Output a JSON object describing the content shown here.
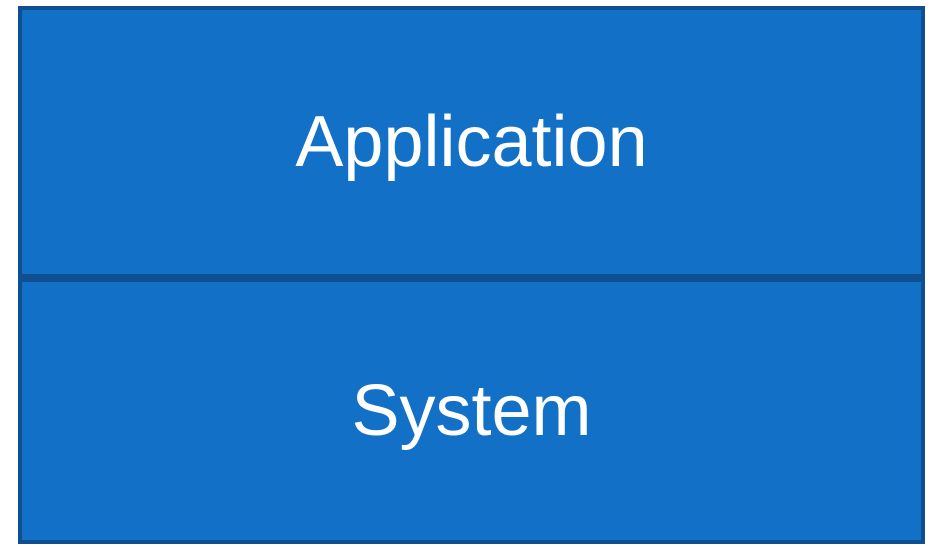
{
  "diagram": {
    "colors": {
      "fill": "#1270c6",
      "border": "#0d4f91",
      "text": "#ffffff"
    },
    "layers": [
      {
        "label": "Application"
      },
      {
        "label": "System"
      }
    ]
  }
}
